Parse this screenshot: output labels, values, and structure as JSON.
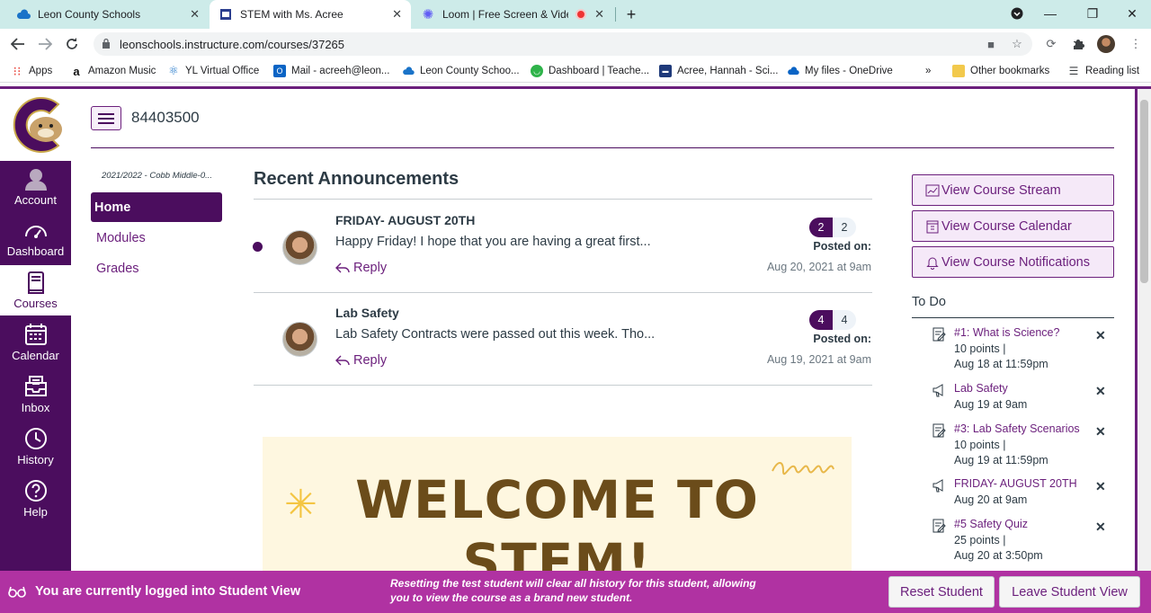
{
  "browser": {
    "tabs": [
      {
        "title": "Leon County Schools"
      },
      {
        "title": "STEM with Ms. Acree"
      },
      {
        "title": "Loom | Free Screen & Video"
      }
    ],
    "url": "leonschools.instructure.com/courses/37265",
    "bookmarks": [
      {
        "label": "Apps"
      },
      {
        "label": "Amazon Music"
      },
      {
        "label": "YL Virtual Office"
      },
      {
        "label": "Mail - acreeh@leon..."
      },
      {
        "label": "Leon County Schoo..."
      },
      {
        "label": "Dashboard | Teache..."
      },
      {
        "label": "Acree, Hannah - Sci..."
      },
      {
        "label": "My files - OneDrive"
      },
      {
        "label": "»"
      },
      {
        "label": "Other bookmarks"
      },
      {
        "label": "Reading list"
      }
    ]
  },
  "global_nav": {
    "items": [
      {
        "label": "Account",
        "icon": "account-icon"
      },
      {
        "label": "Dashboard",
        "icon": "dashboard-icon"
      },
      {
        "label": "Courses",
        "icon": "courses-icon"
      },
      {
        "label": "Calendar",
        "icon": "calendar-icon"
      },
      {
        "label": "Inbox",
        "icon": "inbox-icon"
      },
      {
        "label": "History",
        "icon": "history-icon"
      },
      {
        "label": "Help",
        "icon": "help-icon"
      }
    ],
    "active": "Courses"
  },
  "course": {
    "code": "84403500",
    "term": "2021/2022 - Cobb Middle-0...",
    "nav": [
      {
        "label": "Home"
      },
      {
        "label": "Modules"
      },
      {
        "label": "Grades"
      }
    ]
  },
  "announcements": {
    "heading": "Recent Announcements",
    "items": [
      {
        "title": "FRIDAY- AUGUST 20TH",
        "message": "Happy Friday!  I hope that you are having a great first...",
        "reply": "Reply",
        "unread": "2",
        "total": "2",
        "posted_label": "Posted on:",
        "posted_date": "Aug 20, 2021 at 9am"
      },
      {
        "title": "Lab Safety",
        "message": "Lab Safety Contracts were passed out this week. Tho...",
        "reply": "Reply",
        "unread": "4",
        "total": "4",
        "posted_label": "Posted on:",
        "posted_date": "Aug 19, 2021 at 9am"
      }
    ]
  },
  "banner": {
    "text_line1": "WELCOME TO",
    "text_line2": "STEM!"
  },
  "sidebar": {
    "buttons": [
      {
        "label": "View Course Stream"
      },
      {
        "label": "View Course Calendar"
      },
      {
        "label": "View Course Notifications"
      }
    ],
    "todo_heading": "To Do",
    "todo": [
      {
        "title": "#1: What is Science?",
        "line2": "10 points   |",
        "line3": "Aug 18 at 11:59pm",
        "icon": "assignment-icon"
      },
      {
        "title": "Lab Safety",
        "line2": "Aug 19 at 9am",
        "line3": "",
        "icon": "announcement-icon"
      },
      {
        "title": "#3: Lab Safety Scenarios",
        "line2": "10 points   |",
        "line3": "Aug 19 at 11:59pm",
        "icon": "assignment-icon"
      },
      {
        "title": "FRIDAY- AUGUST 20TH",
        "line2": "Aug 20 at 9am",
        "line3": "",
        "icon": "announcement-icon"
      },
      {
        "title": "#5 Safety Quiz",
        "line2": "25 points   |",
        "line3": "Aug 20 at 3:50pm",
        "icon": "assignment-icon"
      }
    ]
  },
  "student_view": {
    "status": "You are currently logged into Student View",
    "message": "Resetting the test student will clear all history for this student, allowing you to view the course as a brand new student.",
    "reset_label": "Reset Student",
    "leave_label": "Leave Student View"
  },
  "colors": {
    "brand": "#4b0d5e",
    "link": "#6b1f7c",
    "student_bar": "#b032a2",
    "tab_strip": "#cdebe9"
  }
}
